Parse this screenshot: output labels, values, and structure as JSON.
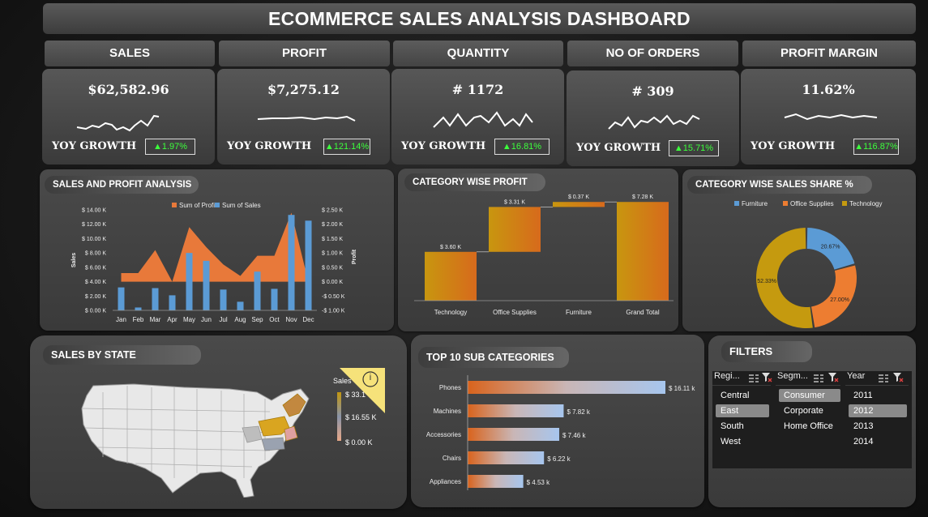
{
  "dashboard": {
    "title": "ECOMMERCE SALES ANALYSIS DASHBOARD"
  },
  "kpis": [
    {
      "label": "SALES",
      "value": "$62,582.96",
      "yoy_label": "YOY GROWTH",
      "yoy": "▲1.97%"
    },
    {
      "label": "PROFIT",
      "value": "$7,275.12",
      "yoy_label": "YOY GROWTH",
      "yoy": "▲121.14%"
    },
    {
      "label": "QUANTITY",
      "value": "# 1172",
      "yoy_label": "YOY GROWTH",
      "yoy": "▲16.81%"
    },
    {
      "label": "NO OF ORDERS",
      "value": "# 309",
      "yoy_label": "YOY GROWTH",
      "yoy": "▲15.71%"
    },
    {
      "label": "PROFIT MARGIN",
      "value": "11.62%",
      "yoy_label": "YOY GROWTH",
      "yoy": "▲116.87%"
    }
  ],
  "sections": {
    "sales_profit": "SALES AND PROFIT ANALYSIS",
    "category_profit": "CATEGORY WISE PROFIT",
    "category_share": "CATEGORY WISE SALES SHARE %",
    "sales_by_state": "SALES BY STATE",
    "top10": "TOP 10 SUB CATEGORIES",
    "filters": "FILTERS"
  },
  "map_legend": {
    "title": "Sales",
    "max": "$ 33.1",
    "mid": "$ 16.55 K",
    "min": "$ 0.00 K",
    "info": "i"
  },
  "filters": {
    "columns": [
      {
        "header": "Regi...",
        "items": [
          "Central",
          "East",
          "South",
          "West"
        ],
        "selected": "East"
      },
      {
        "header": "Segm...",
        "items": [
          "Consumer",
          "Corporate",
          "Home Office"
        ],
        "selected": "Consumer"
      },
      {
        "header": "Year",
        "items": [
          "2011",
          "2012",
          "2013",
          "2014"
        ],
        "selected": "2012"
      }
    ]
  },
  "chart_data": [
    {
      "type": "bar",
      "title": "SALES AND PROFIT ANALYSIS",
      "categories": [
        "Jan",
        "Feb",
        "Mar",
        "Apr",
        "May",
        "Jun",
        "Jul",
        "Aug",
        "Sep",
        "Oct",
        "Nov",
        "Dec"
      ],
      "series": [
        {
          "name": "Sum of Profit",
          "type": "area",
          "axis": "right",
          "color": "#e8793a",
          "values": [
            0.3,
            0.3,
            1.1,
            0.0,
            1.9,
            1.2,
            0.6,
            0.2,
            0.9,
            0.9,
            2.4,
            0.0
          ]
        },
        {
          "name": "Sum of Sales",
          "type": "bar",
          "axis": "left",
          "color": "#5b9bd5",
          "values": [
            3.2,
            0.4,
            3.1,
            2.1,
            8.0,
            6.9,
            2.9,
            1.2,
            5.4,
            3.0,
            13.3,
            12.5
          ]
        }
      ],
      "ylabel": "Sales",
      "y2label": "Profit",
      "yticks": [
        "$ 0.00 K",
        "$ 2.00 K",
        "$ 4.00 K",
        "$ 6.00 K",
        "$ 8.00 K",
        "$ 10.00 K",
        "$ 12.00 K",
        "$ 14.00 K"
      ],
      "y2ticks": [
        "-$ 1.00 K",
        "-$ 0.50 K",
        "$ 0.00 K",
        "$ 0.50 K",
        "$ 1.00 K",
        "$ 1.50 K",
        "$ 2.00 K",
        "$ 2.50 K"
      ],
      "ylim": [
        0,
        14
      ],
      "y2lim": [
        -1,
        2.5
      ],
      "legend": "top"
    },
    {
      "type": "bar",
      "subtype": "waterfall",
      "title": "CATEGORY WISE PROFIT",
      "categories": [
        "Technology",
        "Office Supplies",
        "Furniture",
        "Grand Total"
      ],
      "values": [
        3.6,
        3.31,
        0.37,
        7.28
      ],
      "labels": [
        "$ 3.60 K",
        "$ 3.31 K",
        "$ 0.37 K",
        "$ 7.28 K"
      ]
    },
    {
      "type": "pie",
      "subtype": "donut",
      "title": "CATEGORY WISE SALES SHARE %",
      "categories": [
        "Furniture",
        "Office Supplies",
        "Technology"
      ],
      "values": [
        20.67,
        27.0,
        52.33
      ],
      "labels": [
        "20.67%",
        "27.00%",
        "52.33%"
      ],
      "colors": [
        "#5b9bd5",
        "#ed7d31",
        "#c59a0f"
      ],
      "legend": "top"
    },
    {
      "type": "bar",
      "orientation": "horizontal",
      "title": "TOP 10 SUB CATEGORIES",
      "categories": [
        "Phones",
        "Machines",
        "Accessories",
        "Chairs",
        "Appliances"
      ],
      "values": [
        16.11,
        7.82,
        7.46,
        6.22,
        4.53
      ],
      "labels": [
        "$ 16.11 k",
        "$ 7.82 k",
        "$ 7.46 k",
        "$ 6.22 k",
        "$ 4.53 k"
      ]
    }
  ]
}
